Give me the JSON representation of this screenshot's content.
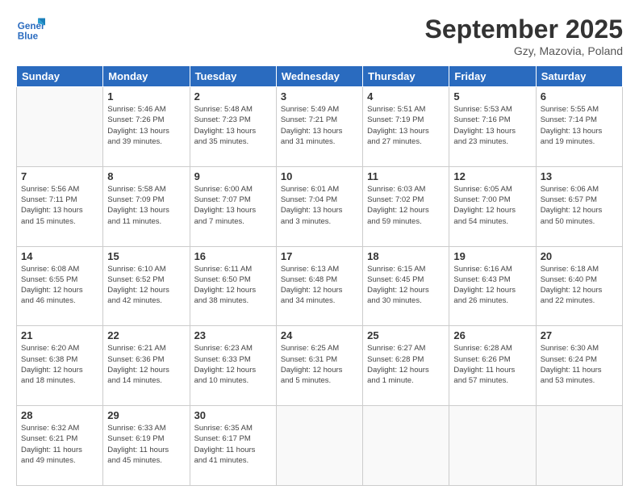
{
  "header": {
    "logo_line1": "General",
    "logo_line2": "Blue",
    "month": "September 2025",
    "location": "Gzy, Mazovia, Poland"
  },
  "weekdays": [
    "Sunday",
    "Monday",
    "Tuesday",
    "Wednesday",
    "Thursday",
    "Friday",
    "Saturday"
  ],
  "weeks": [
    [
      {
        "day": "",
        "info": ""
      },
      {
        "day": "1",
        "info": "Sunrise: 5:46 AM\nSunset: 7:26 PM\nDaylight: 13 hours\nand 39 minutes."
      },
      {
        "day": "2",
        "info": "Sunrise: 5:48 AM\nSunset: 7:23 PM\nDaylight: 13 hours\nand 35 minutes."
      },
      {
        "day": "3",
        "info": "Sunrise: 5:49 AM\nSunset: 7:21 PM\nDaylight: 13 hours\nand 31 minutes."
      },
      {
        "day": "4",
        "info": "Sunrise: 5:51 AM\nSunset: 7:19 PM\nDaylight: 13 hours\nand 27 minutes."
      },
      {
        "day": "5",
        "info": "Sunrise: 5:53 AM\nSunset: 7:16 PM\nDaylight: 13 hours\nand 23 minutes."
      },
      {
        "day": "6",
        "info": "Sunrise: 5:55 AM\nSunset: 7:14 PM\nDaylight: 13 hours\nand 19 minutes."
      }
    ],
    [
      {
        "day": "7",
        "info": "Sunrise: 5:56 AM\nSunset: 7:11 PM\nDaylight: 13 hours\nand 15 minutes."
      },
      {
        "day": "8",
        "info": "Sunrise: 5:58 AM\nSunset: 7:09 PM\nDaylight: 13 hours\nand 11 minutes."
      },
      {
        "day": "9",
        "info": "Sunrise: 6:00 AM\nSunset: 7:07 PM\nDaylight: 13 hours\nand 7 minutes."
      },
      {
        "day": "10",
        "info": "Sunrise: 6:01 AM\nSunset: 7:04 PM\nDaylight: 13 hours\nand 3 minutes."
      },
      {
        "day": "11",
        "info": "Sunrise: 6:03 AM\nSunset: 7:02 PM\nDaylight: 12 hours\nand 59 minutes."
      },
      {
        "day": "12",
        "info": "Sunrise: 6:05 AM\nSunset: 7:00 PM\nDaylight: 12 hours\nand 54 minutes."
      },
      {
        "day": "13",
        "info": "Sunrise: 6:06 AM\nSunset: 6:57 PM\nDaylight: 12 hours\nand 50 minutes."
      }
    ],
    [
      {
        "day": "14",
        "info": "Sunrise: 6:08 AM\nSunset: 6:55 PM\nDaylight: 12 hours\nand 46 minutes."
      },
      {
        "day": "15",
        "info": "Sunrise: 6:10 AM\nSunset: 6:52 PM\nDaylight: 12 hours\nand 42 minutes."
      },
      {
        "day": "16",
        "info": "Sunrise: 6:11 AM\nSunset: 6:50 PM\nDaylight: 12 hours\nand 38 minutes."
      },
      {
        "day": "17",
        "info": "Sunrise: 6:13 AM\nSunset: 6:48 PM\nDaylight: 12 hours\nand 34 minutes."
      },
      {
        "day": "18",
        "info": "Sunrise: 6:15 AM\nSunset: 6:45 PM\nDaylight: 12 hours\nand 30 minutes."
      },
      {
        "day": "19",
        "info": "Sunrise: 6:16 AM\nSunset: 6:43 PM\nDaylight: 12 hours\nand 26 minutes."
      },
      {
        "day": "20",
        "info": "Sunrise: 6:18 AM\nSunset: 6:40 PM\nDaylight: 12 hours\nand 22 minutes."
      }
    ],
    [
      {
        "day": "21",
        "info": "Sunrise: 6:20 AM\nSunset: 6:38 PM\nDaylight: 12 hours\nand 18 minutes."
      },
      {
        "day": "22",
        "info": "Sunrise: 6:21 AM\nSunset: 6:36 PM\nDaylight: 12 hours\nand 14 minutes."
      },
      {
        "day": "23",
        "info": "Sunrise: 6:23 AM\nSunset: 6:33 PM\nDaylight: 12 hours\nand 10 minutes."
      },
      {
        "day": "24",
        "info": "Sunrise: 6:25 AM\nSunset: 6:31 PM\nDaylight: 12 hours\nand 5 minutes."
      },
      {
        "day": "25",
        "info": "Sunrise: 6:27 AM\nSunset: 6:28 PM\nDaylight: 12 hours\nand 1 minute."
      },
      {
        "day": "26",
        "info": "Sunrise: 6:28 AM\nSunset: 6:26 PM\nDaylight: 11 hours\nand 57 minutes."
      },
      {
        "day": "27",
        "info": "Sunrise: 6:30 AM\nSunset: 6:24 PM\nDaylight: 11 hours\nand 53 minutes."
      }
    ],
    [
      {
        "day": "28",
        "info": "Sunrise: 6:32 AM\nSunset: 6:21 PM\nDaylight: 11 hours\nand 49 minutes."
      },
      {
        "day": "29",
        "info": "Sunrise: 6:33 AM\nSunset: 6:19 PM\nDaylight: 11 hours\nand 45 minutes."
      },
      {
        "day": "30",
        "info": "Sunrise: 6:35 AM\nSunset: 6:17 PM\nDaylight: 11 hours\nand 41 minutes."
      },
      {
        "day": "",
        "info": ""
      },
      {
        "day": "",
        "info": ""
      },
      {
        "day": "",
        "info": ""
      },
      {
        "day": "",
        "info": ""
      }
    ]
  ]
}
